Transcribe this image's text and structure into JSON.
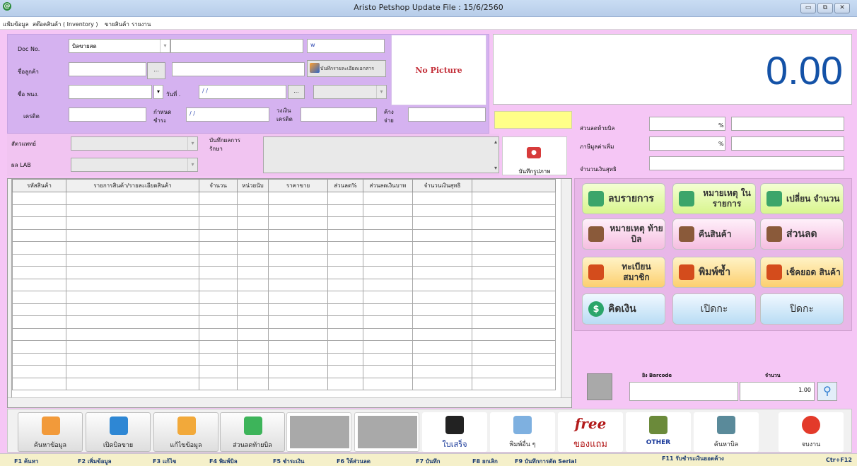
{
  "window": {
    "title": "Aristo Petshop  Update File : 15/6/2560",
    "app_icon": "@",
    "minimize": "▭",
    "restore": "⧉",
    "close": "✕"
  },
  "menu": [
    "แฟ้มข้อมูล",
    "สต๊อคสินค้า ( Inventory )",
    "ขายสินค้า",
    "รายงาน"
  ],
  "doc": {
    "docno_label": "Doc No.",
    "doc_type": "บิลขายสด",
    "docno_value": "",
    "w_field": "w",
    "customer_label": "ชื่อลูกค้า",
    "customer_code": "",
    "customer_name": "",
    "ellipsis": "...",
    "save_detail_label": "บันทึกรายละเอียดเอกสาร",
    "employee_label": "ชื่อ พนง.",
    "employee_value": "",
    "date_label": "วันที่ .",
    "date_value": "/ /",
    "credit_label": "เครดิต",
    "credit_value": "",
    "due_label": "กำหนด ชำระ",
    "due_value": "/ /",
    "credit_limit_label": "วงเงิน เครดิต",
    "credit_limit_value": "",
    "outstanding_label": "ค้าง จ่าย",
    "outstanding_value": ""
  },
  "picture": {
    "no_picture": "No Picture"
  },
  "total": {
    "amount": "0.00"
  },
  "summary": {
    "bill_discount_label": "ส่วนลดท้ายบิล",
    "bill_discount_value": "",
    "pct": "%",
    "vat_label": "ภาษีมูลค่าเพิ่ม",
    "vat_value": "",
    "net_label": "จำนวนเงินสุทธิ",
    "net_value": ""
  },
  "vet": {
    "vet_label": "สัตวแพทย์",
    "lab_label": "ผล LAB",
    "treatment_label": "บันทึกผลการ รักษา",
    "photo_label": "บันทึกรูปภาพ"
  },
  "grid": {
    "headers": [
      "รหัสสินค้า",
      "รายการสินค้า/รายละเอียดสินค้า",
      "จำนวน",
      "หน่วยนับ",
      "ราคาขาย",
      "ส่วนลด%",
      "ส่วนลดเงินบาท",
      "จำนวนเงินสุทธิ",
      ""
    ],
    "rows": 16
  },
  "actions": [
    {
      "key": "delete",
      "label": "ลบรายการ",
      "color": "green",
      "icon": "delete-list-icon"
    },
    {
      "key": "item_note",
      "label": "หมายเหตุ ในรายการ",
      "color": "green",
      "icon": "chat-bubble-icon"
    },
    {
      "key": "change_qty",
      "label": "เปลี่ยน จำนวน",
      "color": "green",
      "icon": "swap-arrows-icon"
    },
    {
      "key": "bill_note",
      "label": "หมายเหตุ ท้ายบิล",
      "color": "pink",
      "icon": "note-pencil-icon"
    },
    {
      "key": "return",
      "label": "คืนสินค้า",
      "color": "pink",
      "icon": "return-arrows-icon"
    },
    {
      "key": "discount",
      "label": "ส่วนลด",
      "color": "pink",
      "icon": "price-tag-icon"
    },
    {
      "key": "register",
      "label": "ทะเบียน สมาชิก",
      "color": "orange",
      "icon": "member-icon"
    },
    {
      "key": "reprint",
      "label": "พิมพ์ซ้ำ",
      "color": "orange",
      "icon": "printer-icon"
    },
    {
      "key": "check_stock",
      "label": "เช็คยอด สินค้า",
      "color": "orange",
      "icon": "stock-check-icon"
    },
    {
      "key": "pay",
      "label": "คิดเงิน",
      "color": "blue",
      "icon": "dollar-coin-icon"
    },
    {
      "key": "open_drawer",
      "label": "เปิดกะ",
      "color": "blue",
      "icon": ""
    },
    {
      "key": "close_drawer",
      "label": "ปิดกะ",
      "color": "blue",
      "icon": ""
    }
  ],
  "barcode": {
    "scan_label": "ยิง Barcode",
    "qty_label": "จำนวน",
    "qty_value": "1.00"
  },
  "bottom_buttons": [
    {
      "label": "ค้นหาข้อมูล",
      "icon": "search-folder-icon"
    },
    {
      "label": "เปิดบิลขาย",
      "icon": "new-bill-icon"
    },
    {
      "label": "แก้ไขข้อมูล",
      "icon": "edit-pencil-icon"
    },
    {
      "label": "ส่วนลดท้ายบิล",
      "icon": "sale-tag-icon"
    },
    {
      "label": "",
      "icon": ""
    },
    {
      "label": "",
      "icon": ""
    },
    {
      "label": "ใบเสร็จ",
      "icon": "receipt-printer-icon"
    },
    {
      "label": "พิมพ์อื่น ๆ",
      "icon": "printer-icon"
    },
    {
      "label": "ของแถม",
      "icon": "free-text-icon",
      "top": "free"
    },
    {
      "label": "OTHER",
      "icon": "money-icon"
    },
    {
      "label": "ค้นหาบิล",
      "icon": "search-bill-icon"
    },
    {
      "label": "จบงาน",
      "icon": "power-icon"
    }
  ],
  "fkeys": [
    "F1 ค้นหา",
    "F2 เพิ่มข้อมูล",
    "F3 แก้ไข",
    "F4 พิมพ์บิล",
    "F5 ชำระเงิน",
    "F6 ให้ส่วนลด",
    "F7 บันทึก",
    "F8 ยกเลิก",
    "F9 บันทึกการตัด Serial",
    "F11 รับชำระเงินยอดค้าง",
    "Ctr+F12"
  ]
}
